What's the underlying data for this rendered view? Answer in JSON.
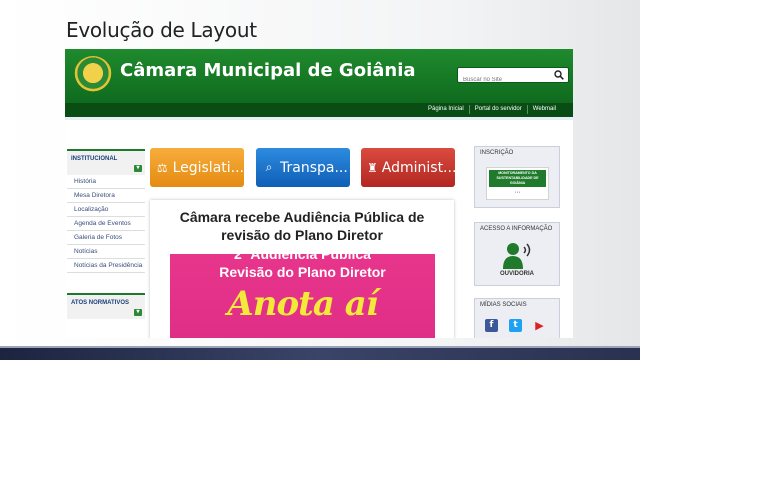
{
  "slide": {
    "title": "Evolução de Layout"
  },
  "site": {
    "name": "Câmara Municipal de Goiânia",
    "search_placeholder": "Buscar no Site",
    "top_links": [
      "Página Inicial",
      "Portal do servidor",
      "Webmail"
    ],
    "brand_green": "#0f6b1e"
  },
  "sidebar": {
    "institucional_title": "INSTITUCIONAL",
    "items": [
      "História",
      "Mesa Diretora",
      "Localização",
      "Agenda de Eventos",
      "Galeria de Fotos",
      "Notícias",
      "Notícias da Presidência"
    ],
    "atos_title": "ATOS NORMATIVOS"
  },
  "buttons": {
    "legislativo": "Legislati...",
    "transparencia": "Transpa...",
    "administrativo": "Administ..."
  },
  "news": {
    "title": "Câmara recebe Audiência Pública de revisão do Plano Diretor",
    "banner_line1": "2ª Audiência Pública",
    "banner_line2": "Revisão do Plano Diretor",
    "banner_line3": "Anota aí"
  },
  "right": {
    "inscricao_title": "INSCRIÇÃO",
    "inscricao_text": "MONITORAMENTO DA SUSTENTABILIDADE DE GOIÂNIA",
    "acesso_title": "ACESSO A INFORMAÇÃO",
    "ouvidoria": "OUVIDORIA",
    "midias_title": "MÍDIAS SOCIAIS",
    "social_icons": [
      "facebook-icon",
      "twitter-icon",
      "youtube-icon"
    ]
  }
}
